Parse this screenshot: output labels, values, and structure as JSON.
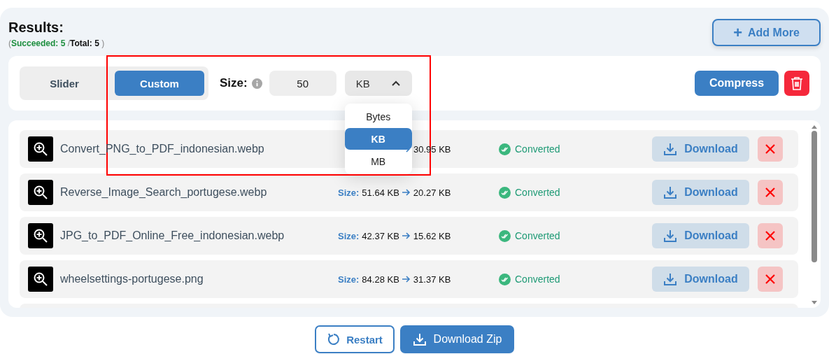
{
  "header": {
    "title": "Results:",
    "open_paren": "(",
    "succeeded": "Succeeded: 5",
    "separator": "/",
    "total": "Total: 5",
    "close_paren": ")"
  },
  "add_button": {
    "icon": "+",
    "label": "Add More"
  },
  "mode_tabs": [
    {
      "label": "Slider",
      "selected": false
    },
    {
      "label": "Custom",
      "selected": true
    }
  ],
  "size": {
    "label": "Size:",
    "value": "50",
    "unit": "KB",
    "expanded": true
  },
  "unit_options": [
    {
      "label": "Bytes",
      "selected": false
    },
    {
      "label": "KB",
      "selected": true
    },
    {
      "label": "MB",
      "selected": false
    }
  ],
  "compress_button": "Compress",
  "files": [
    {
      "name": "Convert_PNG_to_PDF_indonesian.webp",
      "size_to": "30.95 KB",
      "status": "Converted",
      "action": "Download"
    },
    {
      "name": "Reverse_Image_Search_portugese.webp",
      "size_label": "Size:",
      "size_from": "51.64 KB",
      "size_to": "20.27 KB",
      "status": "Converted",
      "action": "Download"
    },
    {
      "name": "JPG_to_PDF_Online_Free_indonesian.webp",
      "size_label": "Size:",
      "size_from": "42.37 KB",
      "size_to": "15.62 KB",
      "status": "Converted",
      "action": "Download"
    },
    {
      "name": "wheelsettings-portugese.png",
      "size_label": "Size:",
      "size_from": "84.28 KB",
      "size_to": "31.37 KB",
      "status": "Converted",
      "action": "Download"
    }
  ],
  "footer": {
    "restart": "Restart",
    "download_zip": "Download Zip"
  }
}
